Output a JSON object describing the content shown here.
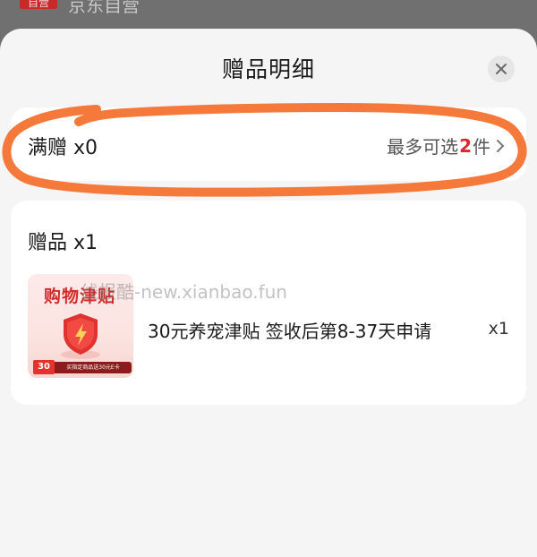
{
  "background": {
    "tag_label": "自营",
    "tag_text": "京东自营"
  },
  "sheet": {
    "title": "赠品明细"
  },
  "manzeng": {
    "label": "满赠 x0",
    "max_prefix": "最多可选",
    "max_count": "2",
    "max_suffix": "件"
  },
  "zengpin": {
    "label": "赠品 x1",
    "item": {
      "thumb_title": "购物津贴",
      "thumb_tag": "30",
      "thumb_ribbon": "买指定商品送30元E卡",
      "name": "30元养宠津贴 签收后第8-37天申请",
      "qty": "x1"
    }
  },
  "watermark": "线报酷-new.xianbao.fun",
  "colors": {
    "accent_red": "#e0262d",
    "annotation_orange": "#f5793b"
  }
}
